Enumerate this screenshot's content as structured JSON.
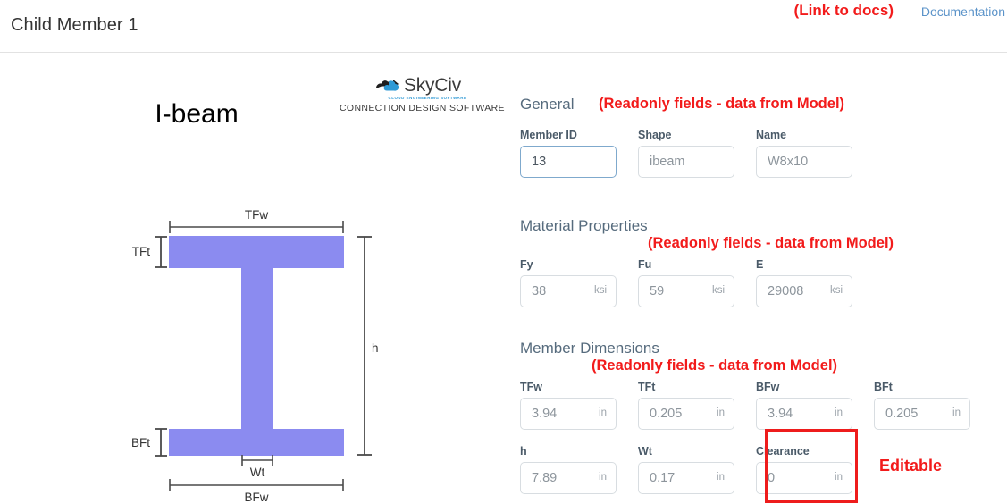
{
  "header": {
    "title": "Child Member 1",
    "docs_annotation": "(Link to docs)",
    "docs_link": "Documentation"
  },
  "brand": {
    "name_sky": "Sky",
    "name_civ": "Civ",
    "tagline": "CLOUD ENGINEERING SOFTWARE",
    "subtitle": "CONNECTION DESIGN SOFTWARE",
    "logo_icon": "cloud-icon"
  },
  "diagram": {
    "title": "I-beam",
    "beam_color": "#8b8bf0",
    "line_color": "#4a4a4a",
    "labels": {
      "top_flange_width": "TFw",
      "top_flange_thickness": "TFt",
      "height": "h",
      "bottom_flange_thickness": "BFt",
      "web_thickness": "Wt",
      "bottom_flange_width": "BFw"
    }
  },
  "annotations": {
    "readonly": "(Readonly fields - data from Model)",
    "editable": "Editable",
    "red": "#f21b1b"
  },
  "sections": [
    {
      "title": "General",
      "fields": [
        {
          "label": "Member ID",
          "value": "13",
          "unit": "",
          "state": "active"
        },
        {
          "label": "Shape",
          "value": "ibeam",
          "unit": "",
          "state": "readonly"
        },
        {
          "label": "Name",
          "value": "W8x10",
          "unit": "",
          "state": "readonly"
        }
      ]
    },
    {
      "title": "Material Properties",
      "fields": [
        {
          "label": "Fy",
          "value": "38",
          "unit": "ksi",
          "state": "readonly"
        },
        {
          "label": "Fu",
          "value": "59",
          "unit": "ksi",
          "state": "readonly"
        },
        {
          "label": "E",
          "value": "29008",
          "unit": "ksi",
          "state": "readonly"
        }
      ]
    },
    {
      "title": "Member Dimensions",
      "fields_row1": [
        {
          "label": "TFw",
          "value": "3.94",
          "unit": "in",
          "state": "readonly"
        },
        {
          "label": "TFt",
          "value": "0.205",
          "unit": "in",
          "state": "readonly"
        },
        {
          "label": "BFw",
          "value": "3.94",
          "unit": "in",
          "state": "readonly"
        },
        {
          "label": "BFt",
          "value": "0.205",
          "unit": "in",
          "state": "readonly"
        }
      ],
      "fields_row2": [
        {
          "label": "h",
          "value": "7.89",
          "unit": "in",
          "state": "readonly"
        },
        {
          "label": "Wt",
          "value": "0.17",
          "unit": "in",
          "state": "readonly"
        },
        {
          "label": "Clearance",
          "value": "0",
          "unit": "in",
          "state": "editable"
        }
      ]
    }
  ]
}
